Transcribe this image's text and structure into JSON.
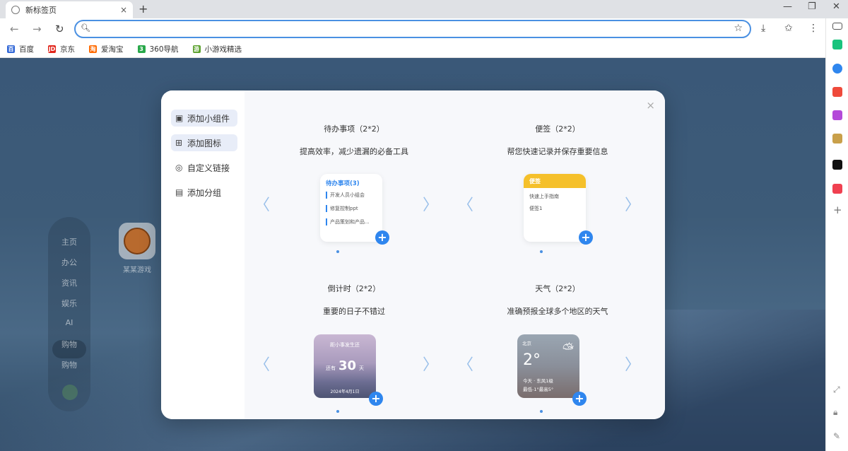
{
  "browser": {
    "tab_title": "新标签页",
    "tab_close": "×",
    "new_tab": "+",
    "win_min": "—",
    "win_restore": "❐",
    "win_close": "✕",
    "nav_back": "←",
    "nav_forward": "→",
    "nav_reload": "↻",
    "omnibox_value": "",
    "omnibox_placeholder": "",
    "bookmarks": [
      {
        "label": "百度",
        "color": "#3066d6",
        "icon": "百"
      },
      {
        "label": "京东",
        "color": "#e1251b",
        "icon": "JD"
      },
      {
        "label": "爱淘宝",
        "color": "#ff6a00",
        "icon": "淘"
      },
      {
        "label": "360导航",
        "color": "#29a84a",
        "icon": "3"
      },
      {
        "label": "小游戏精选",
        "color": "#5aa02c",
        "icon": "游"
      }
    ]
  },
  "background": {
    "nav_items": [
      "主页",
      "办公",
      "资讯",
      "娱乐",
      "AI",
      "购物",
      "购物"
    ],
    "app_label": "某某游戏"
  },
  "modal": {
    "close": "×",
    "side_items": [
      {
        "label": "添加小组件",
        "icon": "▣"
      },
      {
        "label": "添加图标",
        "icon": "⊞"
      },
      {
        "label": "自定义链接",
        "icon": "◎"
      },
      {
        "label": "添加分组",
        "icon": "▤"
      }
    ],
    "cards": [
      {
        "title": "待办事项（2*2）",
        "desc": "提高效率，减少遗漏的必备工具",
        "widget_title": "待办事项(3)",
        "items": [
          "开发人员小组会",
          "修复控制ppt",
          "产品策划和产品..."
        ]
      },
      {
        "title": "便签（2*2）",
        "desc": "帮您快速记录并保存重要信息",
        "widget_title": "便签",
        "lines": [
          "快速上手指南",
          "便签1"
        ]
      },
      {
        "title": "倒计时（2*2）",
        "desc": "重要的日子不错过",
        "widget_top": "距小事发生还",
        "widget_pre": "还有",
        "widget_number": "30",
        "widget_unit": "天",
        "widget_date": "2024年4月1日"
      },
      {
        "title": "天气（2*2）",
        "desc": "准确预报全球多个地区的天气",
        "widget_city": "北京",
        "widget_temp": "2°",
        "widget_line1": "今天 · 东风1级",
        "widget_line2": "最低-1°最高5°"
      }
    ],
    "plus": "+",
    "arrow_left": "〈",
    "arrow_right": "〉"
  }
}
